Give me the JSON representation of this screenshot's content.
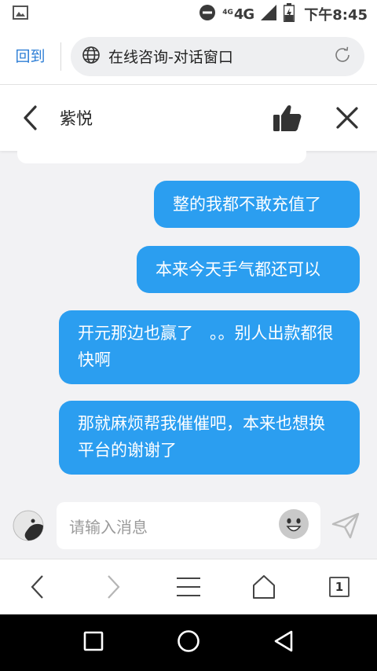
{
  "status_bar": {
    "network_small": "4G",
    "network": "4G",
    "time": "下午8:45",
    "icons": [
      "image-icon",
      "dnd-icon",
      "signal-icon",
      "battery-charging-icon"
    ]
  },
  "browser": {
    "back_label": "回到",
    "url_title": "在线咨询-对话窗口",
    "icons": [
      "globe-icon",
      "refresh-icon"
    ]
  },
  "chat": {
    "title": "紫悦",
    "icons": [
      "back-chevron-icon",
      "thumbs-up-icon",
      "close-icon"
    ],
    "messages": [
      {
        "text": "整的我都不敢充值了",
        "side": "right"
      },
      {
        "text": "本来今天手气都还可以",
        "side": "right"
      },
      {
        "text": "开元那边也赢了　。。别人出款都很快啊",
        "side": "right"
      },
      {
        "text": "那就麻烦帮我催催吧，本来也想换平台的谢谢了",
        "side": "right"
      }
    ],
    "bubble_color": "#2b9ef0"
  },
  "composer": {
    "placeholder": "请输入消息",
    "icons": [
      "avatar-icon",
      "emoji-icon",
      "send-icon"
    ]
  },
  "toolbar": {
    "tab_count": "1",
    "icons": [
      "back-icon",
      "forward-icon",
      "menu-icon",
      "home-icon",
      "tabs-icon"
    ]
  },
  "nav": {
    "icons": [
      "recents-icon",
      "home-circle-icon",
      "back-triangle-icon"
    ]
  }
}
